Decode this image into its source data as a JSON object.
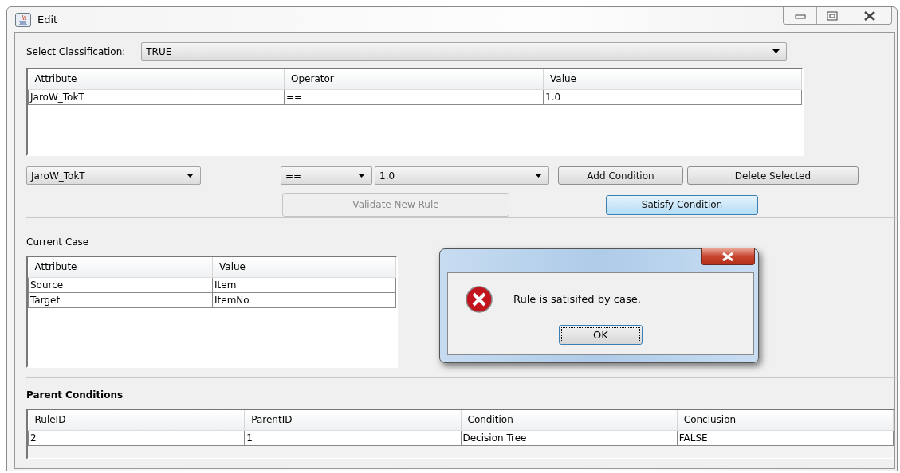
{
  "window": {
    "title": "Edit"
  },
  "classification": {
    "label": "Select Classification:",
    "value": "TRUE"
  },
  "conditions_table": {
    "columns": [
      "Attribute",
      "Operator",
      "Value"
    ],
    "rows": [
      [
        "JaroW_TokT",
        "==",
        "1.0"
      ]
    ]
  },
  "editor": {
    "attribute": "JaroW_TokT",
    "operator": "==",
    "value": "1.0"
  },
  "buttons": [
    {
      "label": "Add Condition",
      "disabled": false,
      "highlighted": false
    },
    {
      "label": "Delete Selected",
      "disabled": false,
      "highlighted": false
    },
    {
      "label": "Validate New Rule",
      "disabled": true,
      "highlighted": false
    },
    {
      "label": "Satisfy Condition",
      "disabled": false,
      "highlighted": true
    }
  ],
  "current_case": {
    "title": "Current Case",
    "columns": [
      "Attribute",
      "Value"
    ],
    "rows": [
      [
        "Source",
        "Item"
      ],
      [
        "Target",
        "ItemNo"
      ]
    ]
  },
  "parent_conditions": {
    "title": "Parent Conditions",
    "columns": [
      "RuleID",
      "ParentID",
      "Condition",
      "Conclusion"
    ],
    "rows": [
      [
        "2",
        "1",
        "Decision Tree",
        "FALSE"
      ]
    ]
  },
  "dialog": {
    "message": "Rule is satisifed by case.",
    "button": "OK"
  }
}
